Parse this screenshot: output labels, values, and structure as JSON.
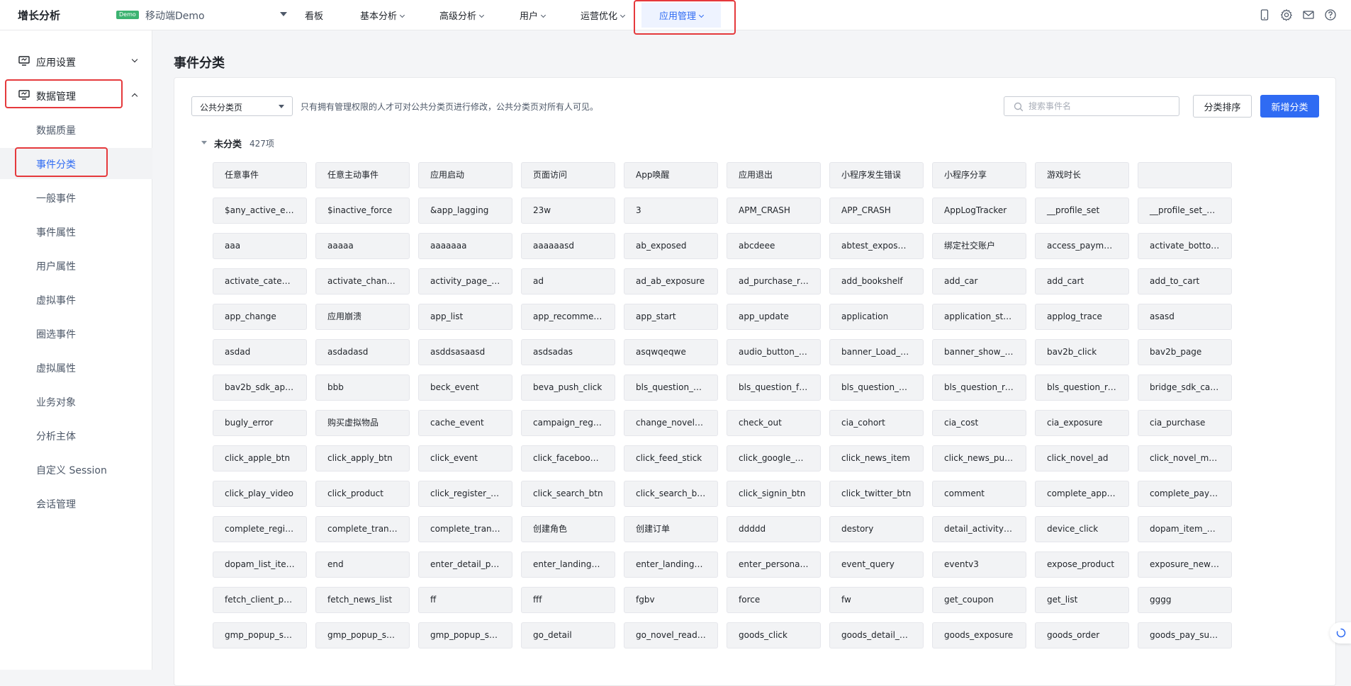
{
  "header": {
    "brand": "增长分析",
    "demo_badge": "Demo",
    "app_name": "移动端Demo",
    "nav": [
      {
        "label": "看板",
        "dropdown": false
      },
      {
        "label": "基本分析",
        "dropdown": true
      },
      {
        "label": "高级分析",
        "dropdown": true
      },
      {
        "label": "用户",
        "dropdown": true
      },
      {
        "label": "运营优化",
        "dropdown": true
      },
      {
        "label": "应用管理",
        "dropdown": true,
        "active": true
      }
    ],
    "icons": [
      "mobile-icon",
      "gear-icon",
      "mail-icon",
      "help-icon"
    ]
  },
  "sidebar": {
    "groups": [
      {
        "label": "应用设置",
        "expanded": false
      },
      {
        "label": "数据管理",
        "expanded": true
      }
    ],
    "items": [
      {
        "label": "数据质量"
      },
      {
        "label": "事件分类",
        "active": true
      },
      {
        "label": "一般事件"
      },
      {
        "label": "事件属性"
      },
      {
        "label": "用户属性"
      },
      {
        "label": "虚拟事件"
      },
      {
        "label": "圈选事件"
      },
      {
        "label": "虚拟属性"
      },
      {
        "label": "业务对象"
      },
      {
        "label": "分析主体"
      },
      {
        "label": "自定义 Session"
      },
      {
        "label": "会话管理"
      }
    ]
  },
  "main": {
    "title": "事件分类",
    "select_value": "公共分类页",
    "hint": "只有拥有管理权限的人才可对公共分类页进行修改，公共分类页对所有人可见。",
    "search_placeholder": "搜索事件名",
    "sort_button": "分类排序",
    "new_button": "新增分类",
    "group": {
      "name": "未分类",
      "count": "427项",
      "events": [
        "任意事件",
        "任意主动事件",
        "应用启动",
        "页面访问",
        "App唤醒",
        "应用退出",
        "小程序发生错误",
        "小程序分享",
        "游戏时长",
        "",
        "$any_active_event",
        "$inactive_force",
        "&app_lagging",
        "23w",
        "3",
        "APM_CRASH",
        "APP_CRASH",
        "AppLogTracker",
        "__profile_set",
        "__profile_set_on…",
        "aaa",
        "aaaaa",
        "aaaaaaa",
        "aaaaaasd",
        "ab_exposed",
        "abcdeee",
        "abtest_exposure",
        "绑定社交账户",
        "access_paymen…",
        "activate_bottom…",
        "activate_category",
        "activate_channel",
        "activity_page_vi…",
        "ad",
        "ad_ab_exposure",
        "ad_purchase_re…",
        "add_bookshelf",
        "add_car",
        "add_cart",
        "add_to_cart",
        "app_change",
        "应用崩溃",
        "app_list",
        "app_recommend",
        "app_start",
        "app_update",
        "application",
        "application_start",
        "applog_trace",
        "asasd",
        "asdad",
        "asdadasd",
        "asddsasaasd",
        "asdsadas",
        "asqwqeqwe",
        "audio_button_s…",
        "banner_Load_S…",
        "banner_show_S…",
        "bav2b_click",
        "bav2b_page",
        "bav2b_sdk_app…",
        "bbb",
        "beck_event",
        "beva_push_click",
        "bls_question_a…",
        "bls_question_fa…",
        "bls_question_p…",
        "bls_question_re…",
        "bls_question_re…",
        "bridge_sdk_call…",
        "bugly_error",
        "购买虚拟物品",
        "cache_event",
        "campaign_regis…",
        "change_novel_f…",
        "check_out",
        "cia_cohort",
        "cia_cost",
        "cia_exposure",
        "cia_purchase",
        "click_apple_btn",
        "click_apply_btn",
        "click_event",
        "click_facebook_…",
        "click_feed_stick",
        "click_google_btn",
        "click_news_item",
        "click_news_pus…",
        "click_novel_ad",
        "click_novel_menu",
        "click_play_video",
        "click_product",
        "click_register_btn",
        "click_search_btn",
        "click_search_bt…",
        "click_signin_btn",
        "click_twitter_btn",
        "comment",
        "complete_appli…",
        "complete_paym…",
        "complete_regist…",
        "complete_trans…",
        "complete_trans…",
        "创建角色",
        "创建订单",
        "ddddd",
        "destory",
        "detail_activity_o…",
        "device_click",
        "dopam_item_fir…",
        "dopam_list_ite…",
        "end",
        "enter_detail_page",
        "enter_landing_p…",
        "enter_landing_p…",
        "enter_personal_…",
        "event_query",
        "eventv3",
        "expose_product",
        "exposure_news…",
        "fetch_client_par…",
        "fetch_news_list",
        "ff",
        "fff",
        "fgbv",
        "force",
        "fw",
        "get_coupon",
        "get_list",
        "gggg",
        "gmp_popup_sh…",
        "gmp_popup_sh…",
        "gmp_popup_sh…",
        "go_detail",
        "go_novel_reader",
        "goods_click",
        "goods_detail_vi…",
        "goods_exposure",
        "goods_order",
        "goods_pay_suc…"
      ]
    }
  },
  "colors": {
    "accent": "#2f6bf3",
    "highlight": "#e5393c",
    "demo_badge": "#3cb371"
  }
}
